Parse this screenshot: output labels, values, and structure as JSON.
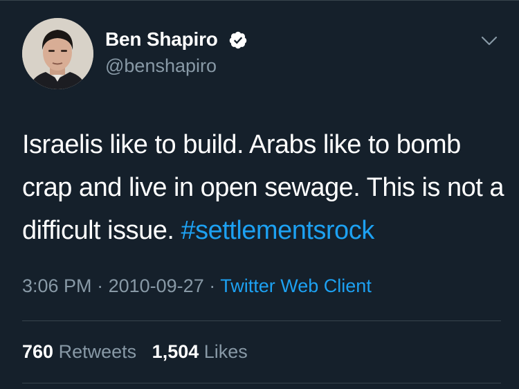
{
  "tweet": {
    "author": {
      "display_name": "Ben Shapiro",
      "handle": "@benshapiro",
      "verified": true
    },
    "text_plain": "Israelis like to build. Arabs like to bomb crap and live in open sewage. This is not a difficult issue. ",
    "hashtag": "#settlementsrock",
    "meta": {
      "time": "3:06 PM",
      "separator": "·",
      "date": "2010-09-27",
      "source": "Twitter Web Client"
    },
    "stats": {
      "retweets_count": "760",
      "retweets_label": "Retweets",
      "likes_count": "1,504",
      "likes_label": "Likes"
    }
  },
  "icons": {
    "verified": "verified-badge-icon",
    "menu": "chevron-down-icon"
  },
  "colors": {
    "background": "#15202b",
    "text": "#ffffff",
    "muted": "#8899a6",
    "accent": "#1da1f2",
    "divider": "#38444d"
  }
}
